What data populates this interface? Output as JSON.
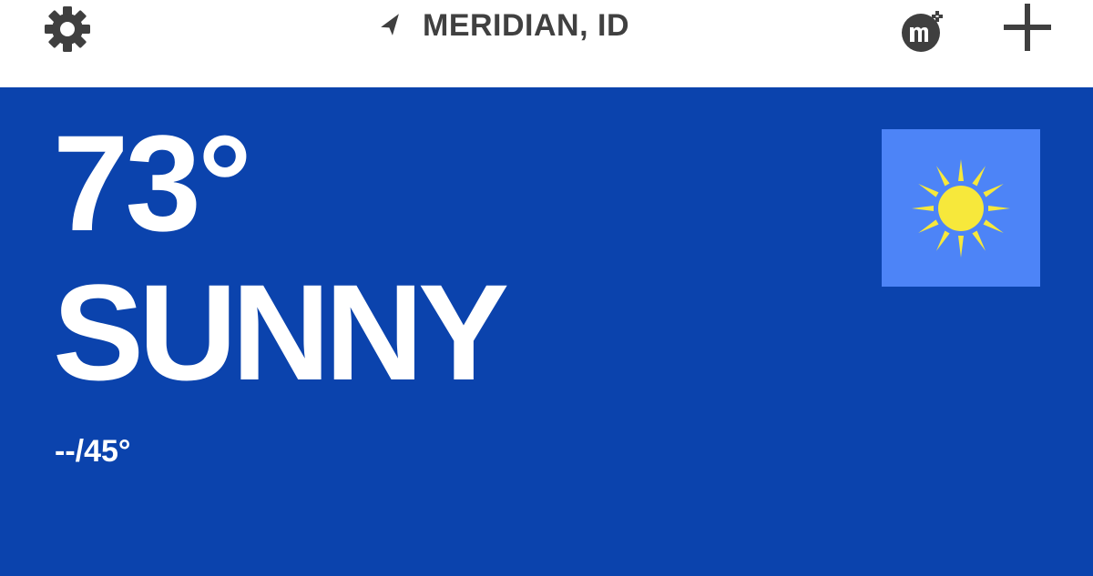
{
  "header": {
    "settings_icon": "gear-icon",
    "location_icon": "location-arrow-icon",
    "location_name": "MERIDIAN, ID",
    "mplus_icon": "mplus-logo-icon",
    "add_icon": "plus-icon"
  },
  "current": {
    "temperature": "73°",
    "condition": "SUNNY",
    "hi_lo": "--/45°",
    "condition_icon": "sun-icon"
  },
  "colors": {
    "header_bg": "#ffffff",
    "panel_bg": "#0b43ad",
    "tile_bg": "#4d84f7",
    "sun": "#f7e83b",
    "header_text": "#404040"
  }
}
